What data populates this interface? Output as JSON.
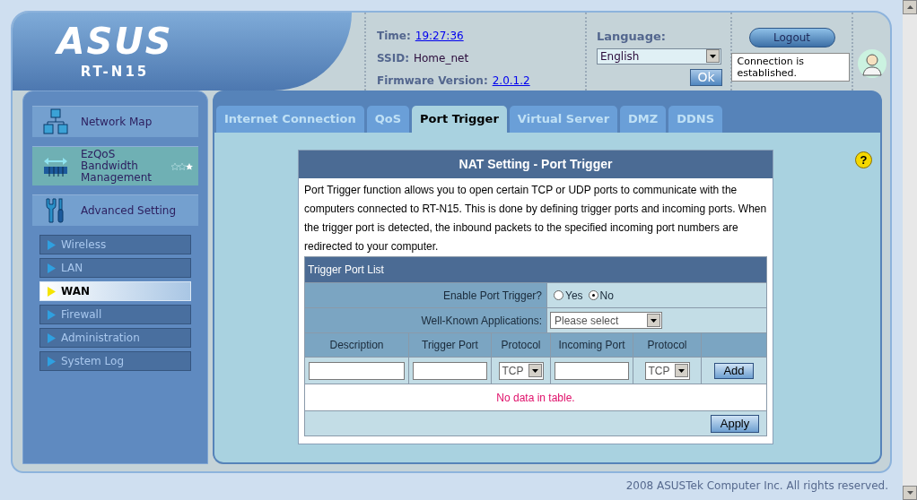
{
  "header": {
    "logo": "ASUS",
    "model": "RT-N15",
    "time_label": "Time:",
    "time": "19:27:36",
    "ssid_label": "SSID:",
    "ssid": "Home_net",
    "firmware_label": "Firmware Version:",
    "firmware": "2.0.1.2",
    "language_label": "Language:",
    "language": "English",
    "ok_button": "Ok",
    "logout_button": "Logout",
    "status_message": "Connection is established."
  },
  "sidebar": {
    "menu": [
      {
        "kind": "network",
        "label": "Network Map",
        "selected": false
      },
      {
        "kind": "qos",
        "label": "EzQoS Bandwidth Management",
        "selected": true,
        "stars": 1
      },
      {
        "kind": "tools",
        "label": "Advanced Setting",
        "selected": false
      }
    ],
    "items": [
      {
        "label": "Wireless",
        "selected": false
      },
      {
        "label": "LAN",
        "selected": false
      },
      {
        "label": "WAN",
        "selected": true
      },
      {
        "label": "Firewall",
        "selected": false
      },
      {
        "label": "Administration",
        "selected": false
      },
      {
        "label": "System Log",
        "selected": false
      }
    ]
  },
  "tabs": [
    {
      "label": "Internet Connection",
      "selected": false
    },
    {
      "label": "QoS",
      "selected": false
    },
    {
      "label": "Port Trigger",
      "selected": true
    },
    {
      "label": "Virtual Server",
      "selected": false
    },
    {
      "label": "DMZ",
      "selected": false
    },
    {
      "label": "DDNS",
      "selected": false
    }
  ],
  "help": "?",
  "form": {
    "title": "NAT Setting - Port Trigger",
    "description": "Port Trigger function allows you to open certain TCP or UDP ports to communicate with the computers connected to RT-N15. This is done by defining trigger ports and incoming ports. When the trigger port is detected, the inbound packets to the specified incoming port numbers are redirected to your computer.",
    "list_title": "Trigger Port List",
    "enable_label": "Enable Port Trigger?",
    "enable_options": [
      {
        "label": "Yes",
        "selected": false
      },
      {
        "label": "No",
        "selected": true
      }
    ],
    "apps_label": "Well-Known Applications:",
    "apps_placeholder": "Please select",
    "columns": [
      "Description",
      "Trigger Port",
      "Protocol",
      "Incoming Port",
      "Protocol"
    ],
    "trigger_protocol": "TCP",
    "incoming_protocol": "TCP",
    "add_button": "Add",
    "empty_message": "No data in table.",
    "apply_button": "Apply"
  },
  "footer": "2008 ASUSTek Computer Inc. All rights reserved."
}
